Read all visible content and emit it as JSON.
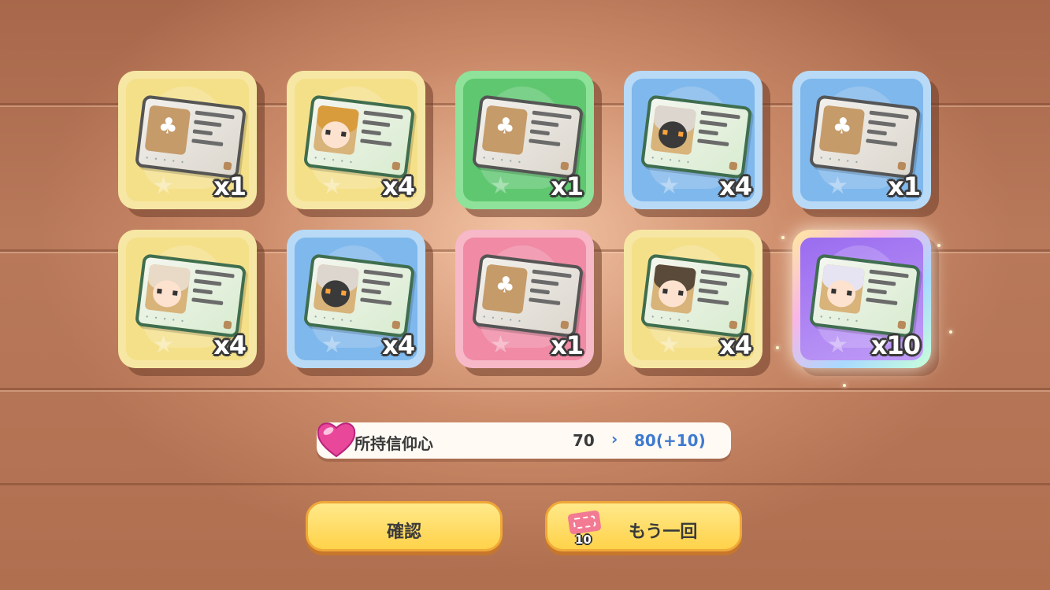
{
  "rewards": [
    {
      "color": "yellow",
      "kind": "sprout",
      "count": "x1"
    },
    {
      "color": "yellow",
      "kind": "face",
      "hair": "#d99c3c",
      "count": "x4"
    },
    {
      "color": "green",
      "kind": "sprout",
      "count": "x1"
    },
    {
      "color": "blue",
      "kind": "face-dark",
      "hair": "#ddd6cf",
      "count": "x4"
    },
    {
      "color": "blue",
      "kind": "sprout",
      "count": "x1"
    },
    {
      "color": "yellow",
      "kind": "face",
      "hair": "#e8dac6",
      "count": "x4"
    },
    {
      "color": "blue",
      "kind": "face-dark",
      "hair": "#ddd6cf",
      "count": "x4"
    },
    {
      "color": "pink",
      "kind": "sprout",
      "count": "x1"
    },
    {
      "color": "yellow",
      "kind": "face",
      "hair": "#5a4a3a",
      "count": "x4"
    },
    {
      "color": "purple",
      "kind": "face",
      "hair": "#e6e4f2",
      "count": "x10"
    }
  ],
  "faith": {
    "label": "所持信仰心",
    "current": "70",
    "arrow": "›",
    "new_value": "80(+10)"
  },
  "buttons": {
    "confirm_label": "確認",
    "again_label": "もう一回",
    "ticket_count": "10"
  }
}
